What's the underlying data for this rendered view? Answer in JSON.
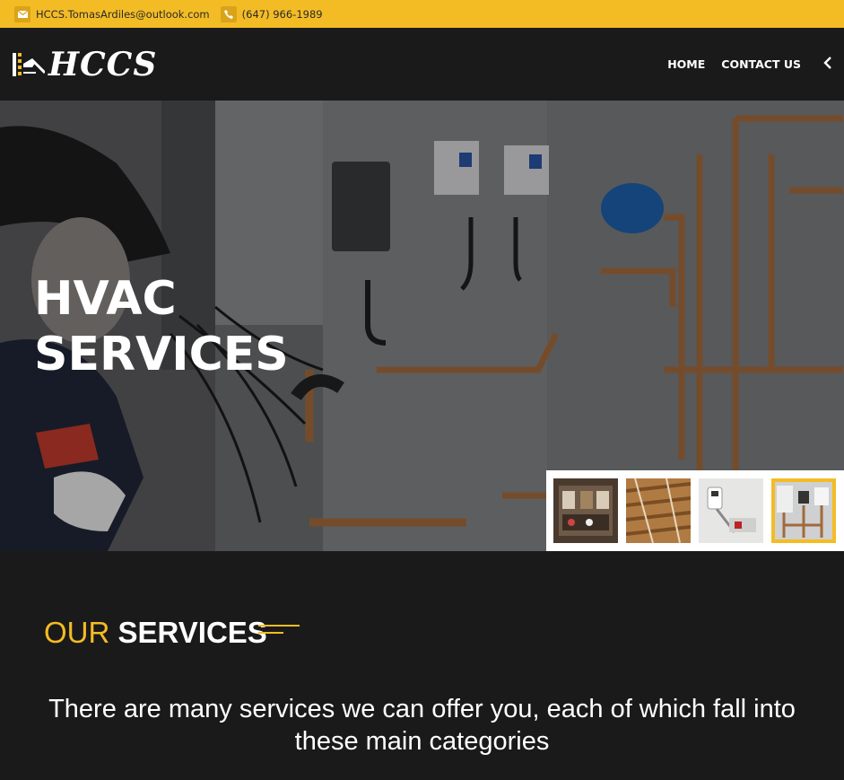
{
  "topbar": {
    "email": "HCCS.TomasArdiles@outlook.com",
    "phone": "(647) 966-1989"
  },
  "header": {
    "logo_text": "HCCS",
    "nav": [
      {
        "label": "HOME"
      },
      {
        "label": "CONTACT US"
      }
    ]
  },
  "hero": {
    "title_line1": "HVAC",
    "title_line2": "SERVICES",
    "thumbnails": [
      {
        "name": "control-panel",
        "active": false
      },
      {
        "name": "wood-ceiling",
        "active": false
      },
      {
        "name": "wall-unit",
        "active": false
      },
      {
        "name": "hvac-panel",
        "active": true
      }
    ]
  },
  "services": {
    "heading_accent": "OUR",
    "heading_main": "SERVICES",
    "description": "There are many services we can offer you, each of which fall into these main categories"
  },
  "colors": {
    "accent": "#f3bc25",
    "dark": "#1b1a1a",
    "white": "#ffffff"
  }
}
